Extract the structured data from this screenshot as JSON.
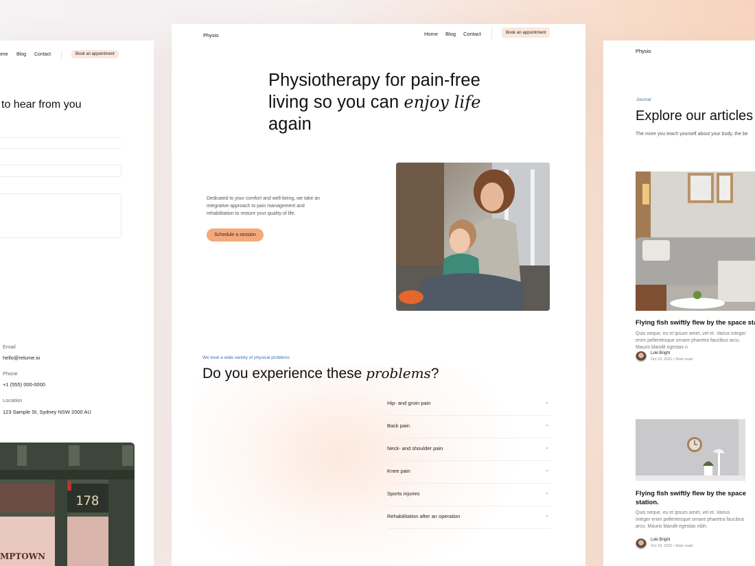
{
  "left_panel": {
    "nav": {
      "home": "ome",
      "blog": "Blog",
      "contact": "Contact",
      "book": "Book an appointment"
    },
    "heading": "to hear from you",
    "contact": {
      "email_label": "Email",
      "email_value": "hello@relume.io",
      "phone_label": "Phone",
      "phone_value": "+1 (555) 000-0000",
      "location_label": "Location",
      "location_value": "123 Sample St, Sydney NSW 2000 AU"
    },
    "storefront": {
      "number": "178",
      "sign": "MPTOWN"
    }
  },
  "center_panel": {
    "brand": "Physio",
    "nav": {
      "home": "Home",
      "blog": "Blog",
      "contact": "Contact",
      "book": "Book an appointment"
    },
    "hero": {
      "title_line1": "Physiotherapy for pain-free",
      "title_line2_plain": "living so you can ",
      "title_line2_em": "enjoy life",
      "title_line3": "again",
      "intro": "Dedicated to your comfort and well-being, we take an integrative approach to pain management and rehabilitation to restore your quality of life.",
      "cta": "Schedule a session"
    },
    "problems": {
      "eyebrow": "We treat a wide variety of physical problems",
      "heading_plain": "Do you experience these ",
      "heading_em": "problems",
      "heading_end": "?",
      "items": [
        "Hip- and groin pain",
        "Back pain",
        "Neck- and shoulder pain",
        "Knee pain",
        "Sports injuries",
        "Rehabilitation after an operation"
      ]
    }
  },
  "right_panel": {
    "brand": "Physio",
    "eyebrow": "Journal",
    "heading": "Explore our articles",
    "lead": "The more you teach yourself about your body, the be",
    "articles": [
      {
        "title": "Flying fish swiftly flew by the space stat",
        "excerpt": "Quis neque, eu et ipsum amet, vel et. Varius integer enim pellentesque ornare pharetra faucibus arcu. Mauris blandit egestas n",
        "author": "Loki Bright",
        "meta": "Oct 19, 2021 • 5min read"
      },
      {
        "title": "Flying fish swiftly flew by the space station.",
        "excerpt": "Quis neque, eu et ipsum amet, vel et. Varius integer enim pellentesque ornare pharetra faucibus arcu. Mauris blandit egestas nibh.",
        "author": "Loki Bright",
        "meta": "Oct 19, 2021 • 5min read"
      }
    ]
  },
  "colors": {
    "accent": "#f3a97c",
    "accent_soft": "#fbe7dd",
    "link_blue": "#3d6fb6"
  }
}
